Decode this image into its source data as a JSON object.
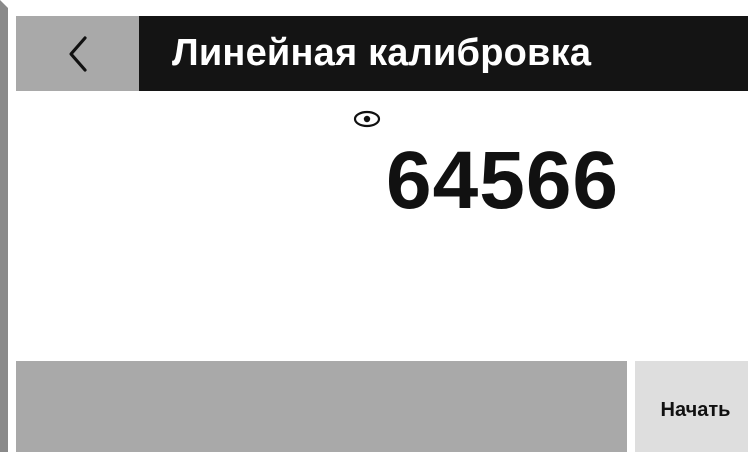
{
  "header": {
    "back_icon": "chevron-left-icon",
    "title": "Линейная калибровка"
  },
  "main": {
    "indicator_icon": "eye-icon",
    "value": "64566"
  },
  "footer": {
    "start_label": "Начать"
  },
  "colors": {
    "title_bar": "#141414",
    "back_button": "#a9a9a9",
    "bottom_bar": "#a9a9a9",
    "start_button": "#dedede"
  }
}
